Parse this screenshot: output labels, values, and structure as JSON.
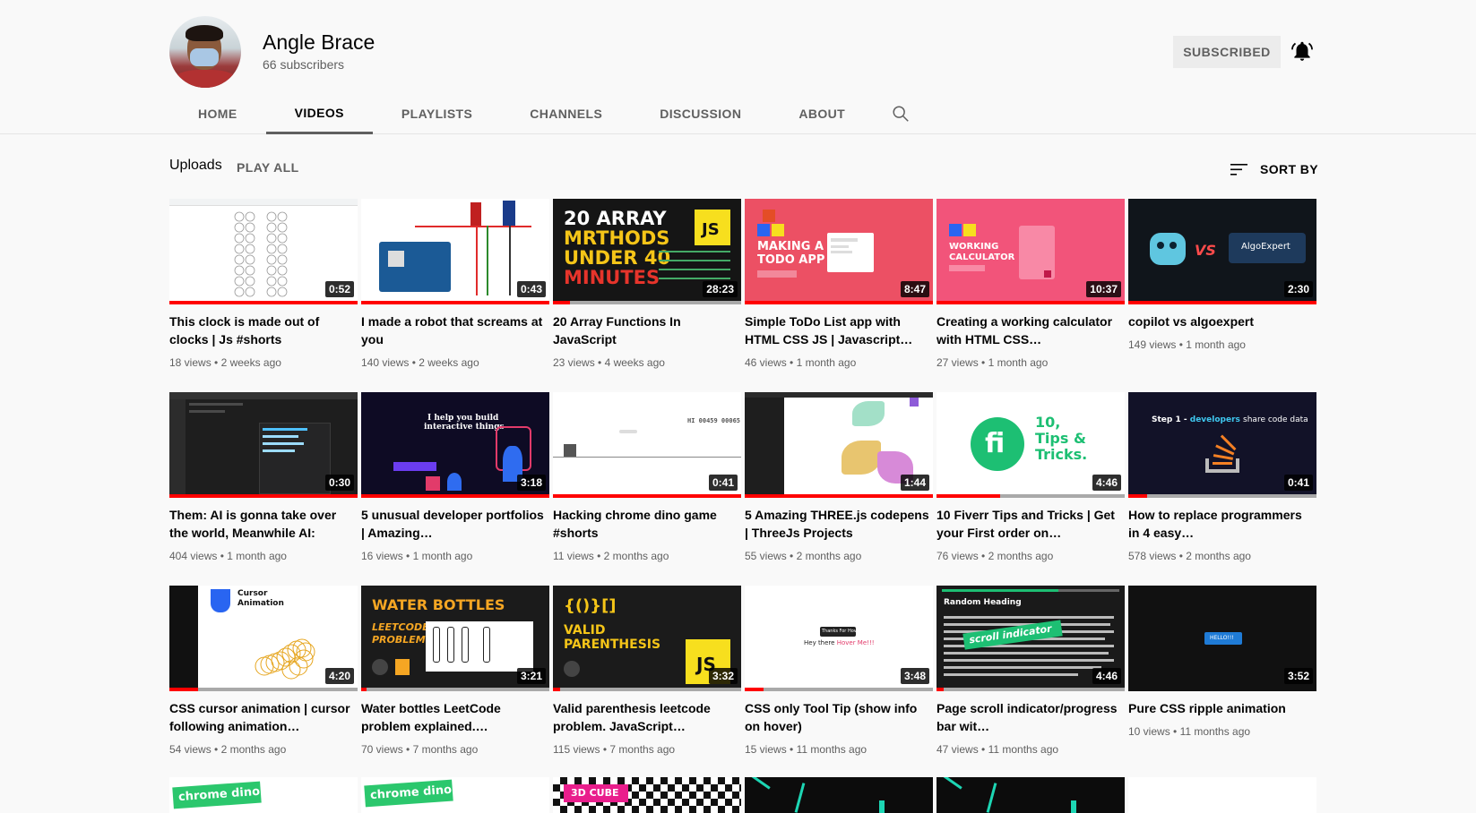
{
  "channel": {
    "name": "Angle Brace",
    "subscribers": "66 subscribers",
    "subscribe_label": "SUBSCRIBED"
  },
  "tabs": [
    {
      "label": "HOME"
    },
    {
      "label": "VIDEOS"
    },
    {
      "label": "PLAYLISTS"
    },
    {
      "label": "CHANNELS"
    },
    {
      "label": "DISCUSSION"
    },
    {
      "label": "ABOUT"
    }
  ],
  "section": {
    "title": "Uploads",
    "play_all": "PLAY ALL",
    "sort_by": "SORT BY"
  },
  "videos": [
    {
      "title": "This clock is made out of clocks | Js #shorts",
      "views": "18 views",
      "ago": "2 weeks ago",
      "duration": "0:52"
    },
    {
      "title": "I made a robot that screams at you",
      "views": "140 views",
      "ago": "2 weeks ago",
      "duration": "0:43"
    },
    {
      "title": "20 Array Functions In JavaScript",
      "views": "23 views",
      "ago": "4 weeks ago",
      "duration": "28:23"
    },
    {
      "title": "Simple ToDo List app with HTML CSS JS | Javascript…",
      "views": "46 views",
      "ago": "1 month ago",
      "duration": "8:47"
    },
    {
      "title": "Creating a working calculator with HTML CSS…",
      "views": "27 views",
      "ago": "1 month ago",
      "duration": "10:37"
    },
    {
      "title": "copilot vs algoexpert",
      "views": "149 views",
      "ago": "1 month ago",
      "duration": "2:30"
    },
    {
      "title": "Them: AI is gonna take over the world, Meanwhile AI:",
      "views": "404 views",
      "ago": "1 month ago",
      "duration": "0:30"
    },
    {
      "title": "5 unusual developer portfolios | Amazing…",
      "views": "16 views",
      "ago": "1 month ago",
      "duration": "3:18"
    },
    {
      "title": "Hacking chrome dino game #shorts",
      "views": "11 views",
      "ago": "2 months ago",
      "duration": "0:41"
    },
    {
      "title": "5 Amazing THREE.js codepens | ThreeJs Projects",
      "views": "55 views",
      "ago": "2 months ago",
      "duration": "1:44"
    },
    {
      "title": "10 Fiverr Tips and Tricks | Get your First order on…",
      "views": "76 views",
      "ago": "2 months ago",
      "duration": "4:46"
    },
    {
      "title": "How to replace programmers in 4 easy…",
      "views": "578 views",
      "ago": "2 months ago",
      "duration": "0:41"
    },
    {
      "title": "CSS cursor animation | cursor following animation…",
      "views": "54 views",
      "ago": "2 months ago",
      "duration": "4:20"
    },
    {
      "title": "Water bottles LeetCode problem explained.…",
      "views": "70 views",
      "ago": "7 months ago",
      "duration": "3:21"
    },
    {
      "title": "Valid parenthesis leetcode problem. JavaScript…",
      "views": "115 views",
      "ago": "7 months ago",
      "duration": "3:32"
    },
    {
      "title": "CSS only Tool Tip (show info on hover)",
      "views": "15 views",
      "ago": "11 months ago",
      "duration": "3:48"
    },
    {
      "title": "Page scroll indicator/progress bar wit…",
      "views": "47 views",
      "ago": "11 months ago",
      "duration": "4:46"
    },
    {
      "title": "Pure CSS ripple animation",
      "views": "10 views",
      "ago": "11 months ago",
      "duration": "3:52"
    }
  ],
  "thumb_text": {
    "t3a": "20 ARRAY",
    "t3b": "MRTHODS",
    "t3c": "UNDER 40",
    "t3d": "MINUTES",
    "t3e": "JS",
    "t4a": "MAKING A",
    "t4b": "TODO APP",
    "t5a": "WORKING",
    "t5b": "CALCULATOR",
    "t6a": "VS",
    "t6b": "AlgoExpert",
    "t8a": "I help you build",
    "t8b": "interactive things",
    "t9a": "HI 00459 00065",
    "t11a": "10,",
    "t11b": "Tips &",
    "t11c": "Tricks.",
    "t12a": "Step 1 -",
    "t12b": "developers",
    "t12c": "share code data",
    "t13a": "Cursor",
    "t13b": "Animation",
    "t14a": "WATER BOTTLES",
    "t14b": "LEETCODE",
    "t14c": "PROBLEM",
    "t15a": "{()}[]",
    "t15b": "VALID",
    "t15c": "PARENTHESIS",
    "t15d": "JS",
    "t16a": "Thanks For Hovering",
    "t16b": "Hey there",
    "t16c": "Hover Me!!!",
    "t17a": "Random Heading",
    "t17b": "scroll indicator",
    "t18a": "HELLO!!!",
    "t19a": "chrome dino",
    "t20a": "chrome dino",
    "t21a": "3D CUBE"
  },
  "colors": {
    "accent_red": "#ff0000",
    "text_primary": "#030303",
    "text_secondary": "#606060"
  }
}
